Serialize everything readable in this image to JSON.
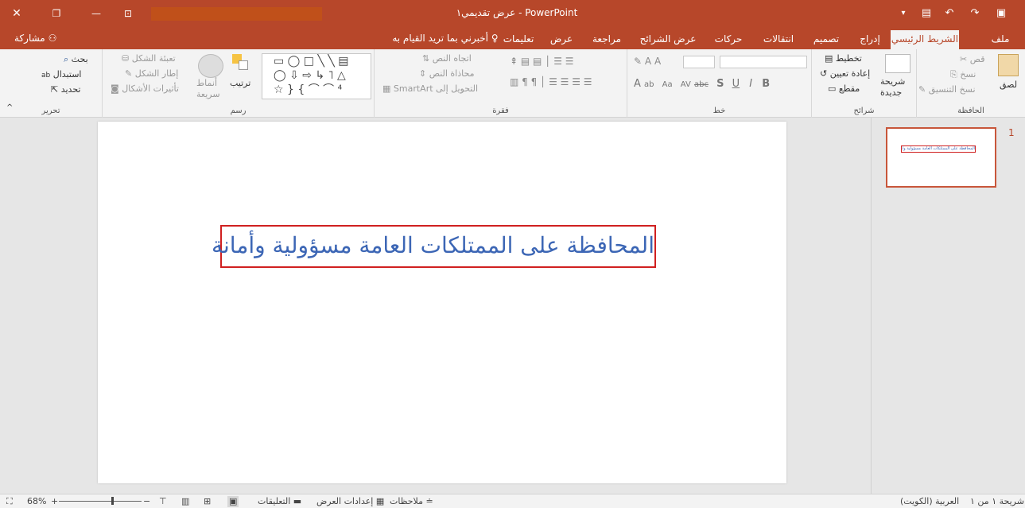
{
  "titlebar": {
    "title": "عرض تقديمي١  -  PowerPoint",
    "close_glyph": "✕",
    "restore_glyph": "❐",
    "minimize_glyph": "—",
    "ribbon_display_glyph": "⊡",
    "save_glyph": "▣",
    "redo_glyph": "↷",
    "undo_glyph": "↶",
    "present_glyph": "▤",
    "customize_glyph": "▾"
  },
  "tabs": {
    "file": "ملف",
    "home": "الشريط الرئيسي",
    "insert": "إدراج",
    "design": "تصميم",
    "transitions": "انتقالات",
    "animations": "حركات",
    "slideshow": "عرض الشرائح",
    "review": "مراجعة",
    "view": "عرض",
    "help": "تعليمات",
    "tell_me": "أخبرني بما تريد القيام به",
    "share": "مشاركة"
  },
  "ribbon": {
    "clipboard": {
      "label": "الحافظة",
      "paste": "لصق",
      "cut": "قص",
      "copy": "نسخ",
      "format_painter": "نسخ التنسيق"
    },
    "slides": {
      "label": "شرائح",
      "new_slide_1": "شريحة",
      "new_slide_2": "جديدة",
      "layout": "تخطيط",
      "reset": "إعادة تعيين",
      "section": "مقطع"
    },
    "font": {
      "label": "خط",
      "bold": "B",
      "italic": "I",
      "underline": "U",
      "shadow": "S",
      "strike": "abc",
      "spacing": "AV",
      "change_case": "Aa",
      "highlight": "ab",
      "font_color": "A",
      "grow": "A",
      "shrink": "A",
      "clear": "A"
    },
    "paragraph": {
      "label": "فقرة",
      "text_direction": "اتجاه النص",
      "align_text": "محاذاة النص",
      "smartart": "التحويل إلى SmartArt"
    },
    "drawing": {
      "label": "رسم",
      "arrange": "ترتيب",
      "quick_styles_1": "أنماط",
      "quick_styles_2": "سريعة",
      "shape_fill": "تعبئة الشكل",
      "shape_outline": "إطار الشكل",
      "shape_effects": "تأثيرات الأشكال"
    },
    "editing": {
      "label": "تحرير",
      "find": "بحث",
      "replace": "استبدال",
      "select": "تحديد"
    }
  },
  "slide": {
    "text": "المحافظة على الممتلكات العامة مسؤولية وأمانة"
  },
  "thumbnails": [
    {
      "number": "1",
      "text": "المحافظة على الممتلكات العامة مسؤولية وأمانة"
    }
  ],
  "statusbar": {
    "slide_info": "شريحة ١ من ١",
    "language": "العربية (الكويت)",
    "notes": "ملاحظات",
    "display_settings": "إعدادات العرض",
    "comments": "التعليقات",
    "zoom": "68%",
    "zoom_level": 0.68
  },
  "colors": {
    "accent": "#b7472a",
    "slide_text": "#3c66b5",
    "textbox_border": "#d02020"
  }
}
